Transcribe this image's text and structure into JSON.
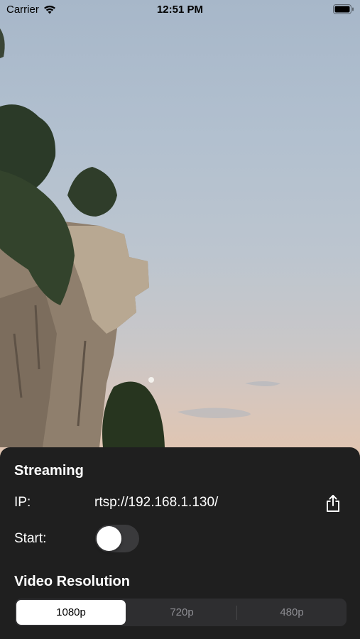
{
  "status_bar": {
    "carrier": "Carrier",
    "time": "12:51 PM",
    "wifi_icon": "wifi-icon",
    "battery_icon": "battery-icon"
  },
  "preview": {
    "description_icon": "camera-preview"
  },
  "streaming": {
    "title": "Streaming",
    "ip_label": "IP:",
    "ip_value": "rtsp://192.168.1.130/",
    "share_icon": "share-icon",
    "start_label": "Start:",
    "start_on": false
  },
  "video_resolution": {
    "title": "Video Resolution",
    "options": [
      "1080p",
      "720p",
      "480p"
    ],
    "selected": "1080p"
  },
  "colors": {
    "panel_bg": "#1f1f1f",
    "toggle_off": "#3a3a3c",
    "segment_bg": "#2e2e30"
  }
}
